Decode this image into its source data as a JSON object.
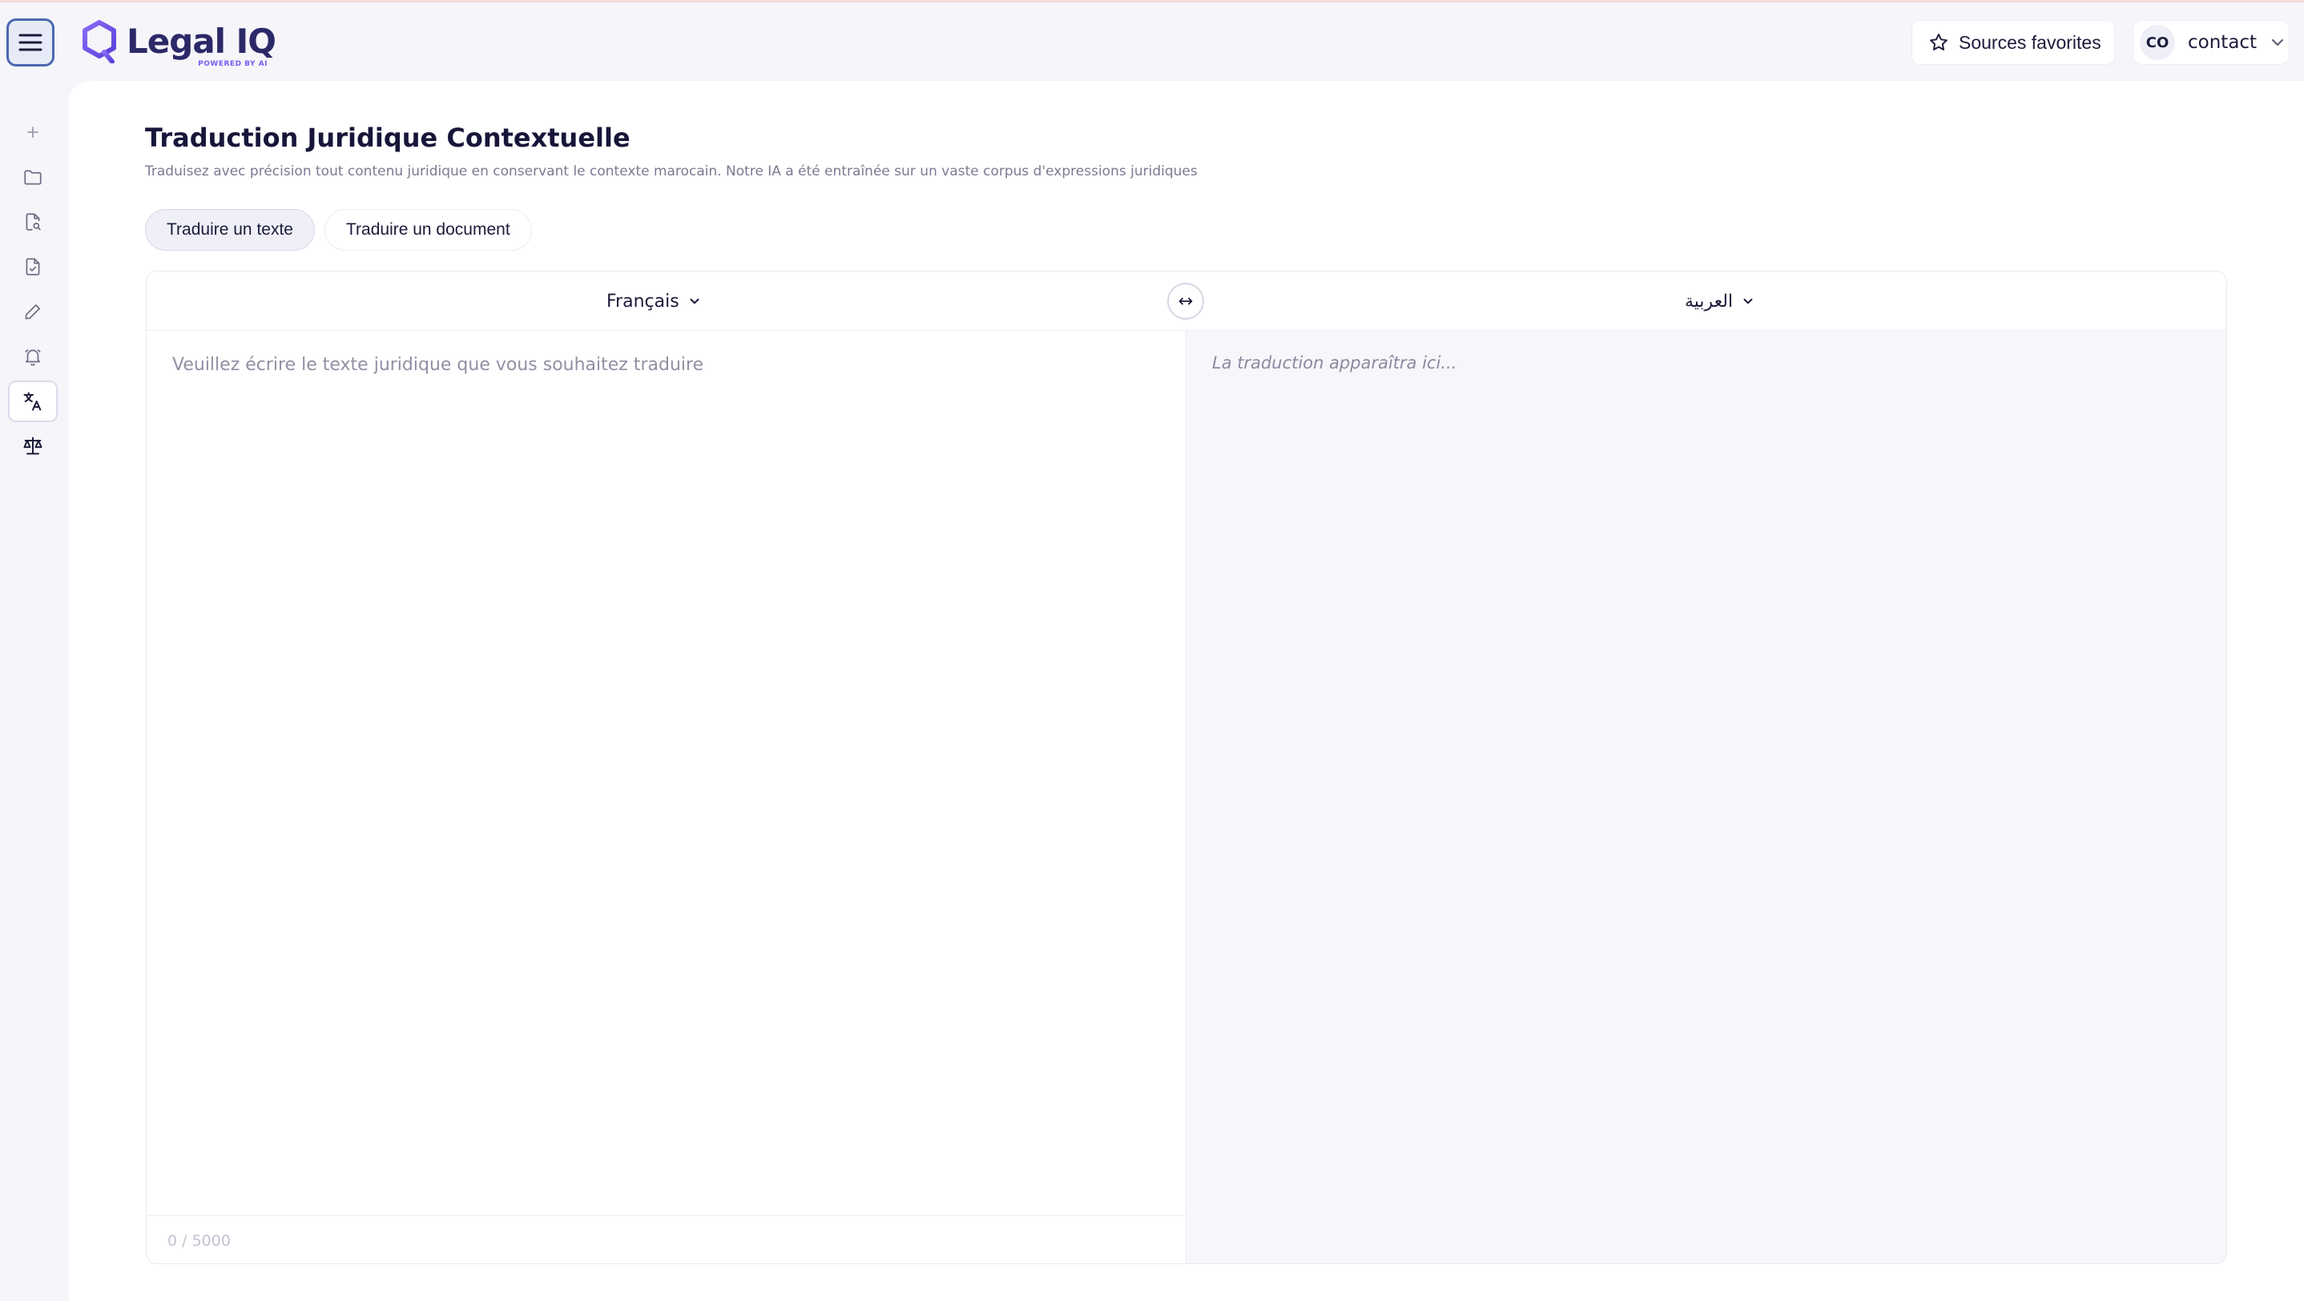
{
  "header": {
    "brand": {
      "name": "Legal IQ",
      "tagline": "POWERED BY AI"
    },
    "favorites_label": "Sources favorites",
    "user": {
      "initials": "CO",
      "name": "contact"
    }
  },
  "sidebar": {
    "items": [
      {
        "icon": "plus-icon",
        "active": false
      },
      {
        "icon": "folder-icon",
        "active": false
      },
      {
        "icon": "document-search-icon",
        "active": false
      },
      {
        "icon": "document-check-icon",
        "active": false
      },
      {
        "icon": "pencil-icon",
        "active": false
      },
      {
        "icon": "bell-icon",
        "active": false
      },
      {
        "icon": "translate-icon",
        "active": true
      },
      {
        "icon": "scales-icon",
        "active": false
      }
    ]
  },
  "page": {
    "title": "Traduction Juridique Contextuelle",
    "subtitle": "Traduisez avec précision tout contenu juridique en conservant le contexte marocain. Notre IA a été entraînée sur un vaste corpus d'expressions juridiques"
  },
  "tabs": [
    {
      "label": "Traduire un texte",
      "active": true
    },
    {
      "label": "Traduire un document",
      "active": false
    }
  ],
  "translator": {
    "source_language": "Français",
    "target_language": "العربية",
    "source_placeholder": "Veuillez écrire le texte juridique que vous souhaitez traduire",
    "source_value": "",
    "char_count": "0 / 5000",
    "translation_placeholder": "La traduction apparaîtra ici..."
  },
  "colors": {
    "brand_primary": "#2c2968",
    "brand_accent": "#7b5cf0",
    "menu_button_border": "#4b68b0"
  }
}
